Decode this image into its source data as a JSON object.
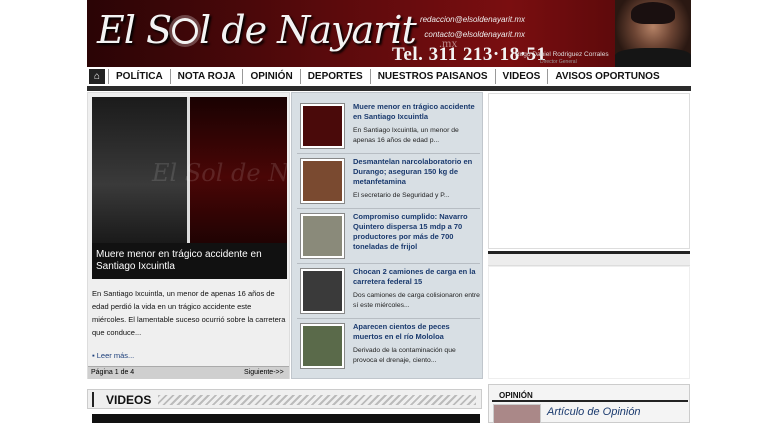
{
  "header": {
    "logo_text_1": "El S",
    "logo_text_2": "l de Nayarit",
    "logo_suffix": ".mx",
    "email_1": "redaccion@elsoldenayarit.mx",
    "email_2": "contacto@elsoldenayarit.mx",
    "phone": "Tel. 311 213·18·51",
    "director_name": "Hugo Daniel Rodriguez Corrales",
    "director_role": "Director General"
  },
  "nav": {
    "home_icon": "home-icon",
    "items": [
      "POLÍTICA",
      "NOTA ROJA",
      "OPINIÓN",
      "DEPORTES",
      "NUESTROS PAISANOS",
      "VIDEOS",
      "AVISOS OPORTUNOS"
    ]
  },
  "featured": {
    "watermark": "El Sol de Nayarit",
    "caption": "Muere menor en trágico accidente en Santiago Ixcuintla",
    "summary": "En Santiago Ixcuintla, un menor de apenas 16 años de edad perdió la vida en un trágico accidente este miércoles. El lamentable suceso ocurrió sobre la carretera que conduce...",
    "read_more": "Leer más...",
    "page": "Página 1 de 4",
    "next": "Siguiente->>"
  },
  "news": [
    {
      "title": "Muere menor en trágico accidente en Santiago Ixcuintla",
      "text": "En Santiago Ixcuintla, un menor de apenas 16 años de edad p...",
      "color": "#4a0a0a"
    },
    {
      "title": "Desmantelan narcolaboratorio en Durango; aseguran 150 kg de metanfetamina",
      "text": "El secretario de Seguridad y P...",
      "color": "#7a4a30"
    },
    {
      "title": "Compromiso cumplido: Navarro Quintero dispersa 15 mdp a 70 productores por más de 700 toneladas de frijol",
      "text": "",
      "color": "#8a8a7a"
    },
    {
      "title": "Chocan 2 camiones de carga en la carretera federal 15",
      "text": "Dos camiones de carga colisionaron entre sí este miércoles...",
      "color": "#3a3a3a"
    },
    {
      "title": "Aparecen cientos de peces muertos en el río Mololoa",
      "text": "Derivado de la contaminación que provoca el drenaje, ciento...",
      "color": "#5a6a4a"
    }
  ],
  "videos": {
    "title": "VIDEOS"
  },
  "opinion": {
    "title": "OPINIÓN",
    "label": "Artículo de Opinión"
  }
}
